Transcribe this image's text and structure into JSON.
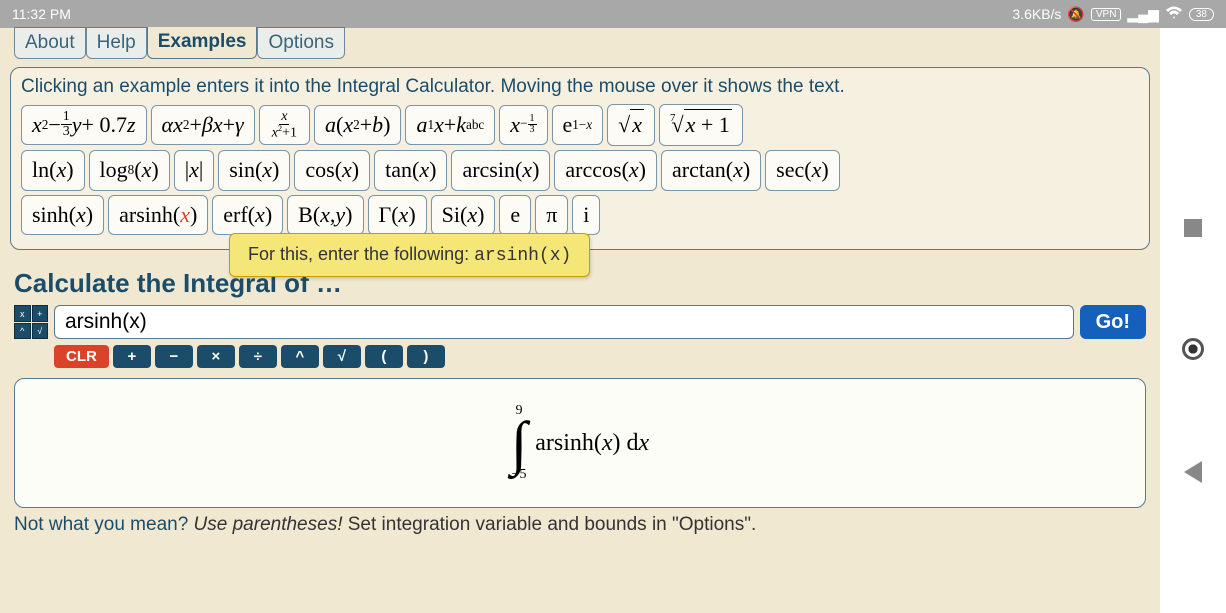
{
  "status": {
    "time": "11:32 PM",
    "speed": "3.6KB/s",
    "vpn": "VPN",
    "battery": "38"
  },
  "tabs": {
    "about": "About",
    "help": "Help",
    "examples": "Examples",
    "options": "Options"
  },
  "intro": "Clicking an example enters it into the Integral Calculator. Moving the mouse over it shows the text.",
  "tooltip": {
    "prefix": "For this, enter the following: ",
    "code": "arsinh(x)"
  },
  "section_title": "Calculate the Integral of …",
  "input": {
    "value": "arsinh(x)",
    "go": "Go!"
  },
  "kbd": {
    "a": "x",
    "b": "+",
    "c": "^",
    "d": "√"
  },
  "calc": {
    "clr": "CLR",
    "plus": "+",
    "minus": "−",
    "times": "×",
    "div": "÷",
    "pow": "^",
    "sqrt": "√",
    "lp": "(",
    "rp": ")"
  },
  "preview": {
    "upper": "9",
    "lower": "−5",
    "fn": "arsinh",
    "var": "x",
    "dx": "d"
  },
  "footer": {
    "q": "Not what you mean? ",
    "hint": "Use parentheses!",
    "rest": " Set integration variable and bounds in \"Options\"."
  },
  "ex": {
    "r2_ln": "ln",
    "r2_log": "log",
    "r2_sin": "sin",
    "r2_cos": "cos",
    "r2_tan": "tan",
    "r2_asin": "arcsin",
    "r2_acos": "arccos",
    "r2_atan": "arctan",
    "r2_sec": "sec",
    "r3_sinh": "sinh",
    "r3_arsinh": "arsinh",
    "r3_erf": "erf",
    "r3_si": "Si",
    "r3_e": "e",
    "r3_pi": "π",
    "r3_i": "i"
  }
}
